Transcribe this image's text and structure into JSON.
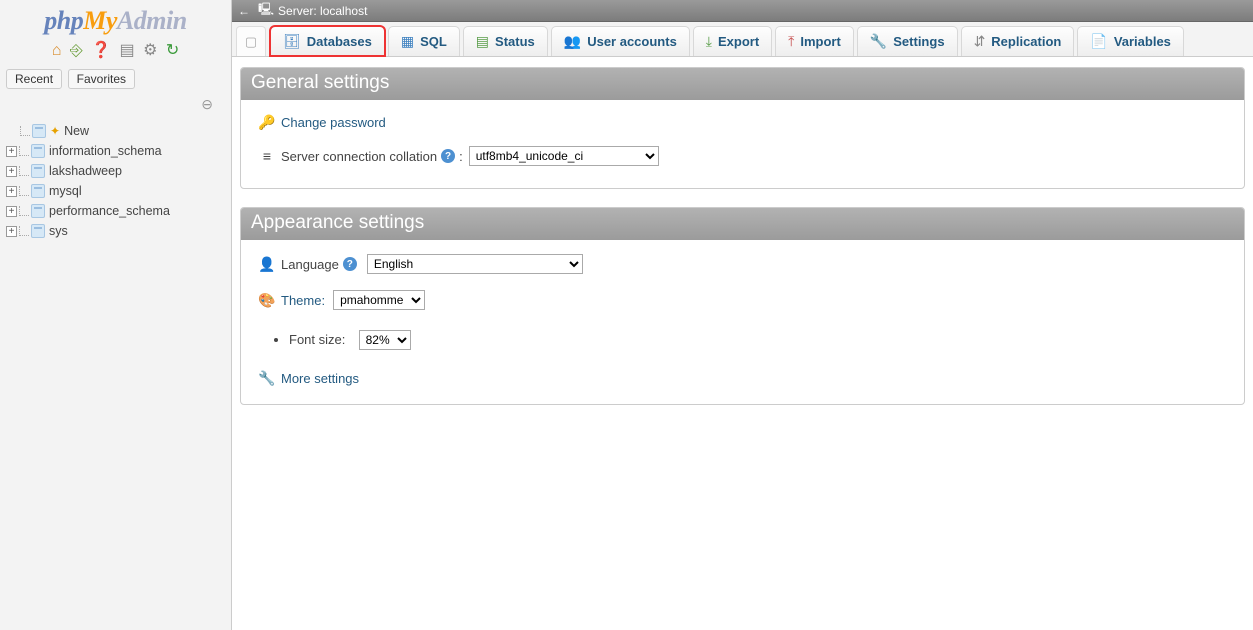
{
  "logo": {
    "p1": "php",
    "p2": "My",
    "p3": "Admin"
  },
  "side_icons": {
    "home": "home-icon",
    "logout": "logout-icon",
    "docs": "docs-icon",
    "nav": "nav-icon",
    "settings": "gear-icon",
    "reload": "reload-icon"
  },
  "side_tabs": {
    "recent": "Recent",
    "fav": "Favorites"
  },
  "tree": {
    "new_label": "New",
    "dbs": [
      {
        "name": "information_schema"
      },
      {
        "name": "lakshadweep"
      },
      {
        "name": "mysql"
      },
      {
        "name": "performance_schema"
      },
      {
        "name": "sys"
      }
    ]
  },
  "breadcrumb": {
    "server_label": "Server:",
    "server_name": "localhost"
  },
  "tabs": [
    {
      "id": "databases",
      "label": "Databases",
      "highlight": true
    },
    {
      "id": "sql",
      "label": "SQL"
    },
    {
      "id": "status",
      "label": "Status"
    },
    {
      "id": "users",
      "label": "User accounts"
    },
    {
      "id": "export",
      "label": "Export"
    },
    {
      "id": "import",
      "label": "Import"
    },
    {
      "id": "settings",
      "label": "Settings"
    },
    {
      "id": "replication",
      "label": "Replication"
    },
    {
      "id": "variables",
      "label": "Variables"
    }
  ],
  "general": {
    "title": "General settings",
    "change_pw": "Change password",
    "collation_label": "Server connection collation",
    "collation_value": "utf8mb4_unicode_ci"
  },
  "appearance": {
    "title": "Appearance settings",
    "language_label": "Language",
    "language_value": "English",
    "theme_label": "Theme:",
    "theme_value": "pmahomme",
    "font_label": "Font size:",
    "font_value": "82%",
    "more": "More settings"
  }
}
